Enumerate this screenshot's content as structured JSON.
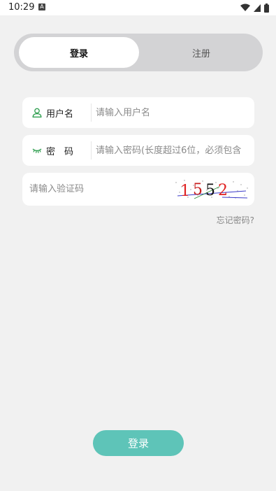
{
  "status_bar": {
    "time": "10:29",
    "notification_badge": "A",
    "icons": [
      "wifi-icon",
      "signal-icon",
      "battery-icon"
    ]
  },
  "tabs": {
    "login": "登录",
    "register": "注册"
  },
  "username_field": {
    "label": "用户名",
    "placeholder": "请输入用户名",
    "icon": "user-icon"
  },
  "password_field": {
    "label": "密　码",
    "placeholder": "请输入密码(长度超过6位，必须包含",
    "icon": "eye-closed-icon"
  },
  "captcha_field": {
    "placeholder": "请输入验证码",
    "code": "1552"
  },
  "forgot_password": "忘记密码?",
  "login_button": "登录",
  "colors": {
    "background": "#f1f1f1",
    "accent": "#5ec4b8",
    "tab_bg": "#d3d3d5",
    "icon_green": "#2e9e4f"
  }
}
